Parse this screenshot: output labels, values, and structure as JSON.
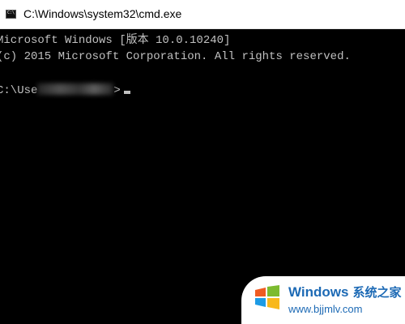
{
  "window": {
    "title": "C:\\Windows\\system32\\cmd.exe",
    "icon": "cmd-icon",
    "icon_label": "C:\\"
  },
  "console": {
    "line1": "Microsoft Windows [版本 10.0.10240]",
    "line2": "(c) 2015 Microsoft Corporation. All rights reserved.",
    "prompt_prefix": "C:\\Use",
    "prompt_suffix": ">",
    "text_color": "#c0c0c0",
    "background": "#000000"
  },
  "watermark": {
    "brand": "Windows",
    "brand_cn": "系统之家",
    "url": "www.bjjmlv.com",
    "color": "#1d6ab5"
  }
}
